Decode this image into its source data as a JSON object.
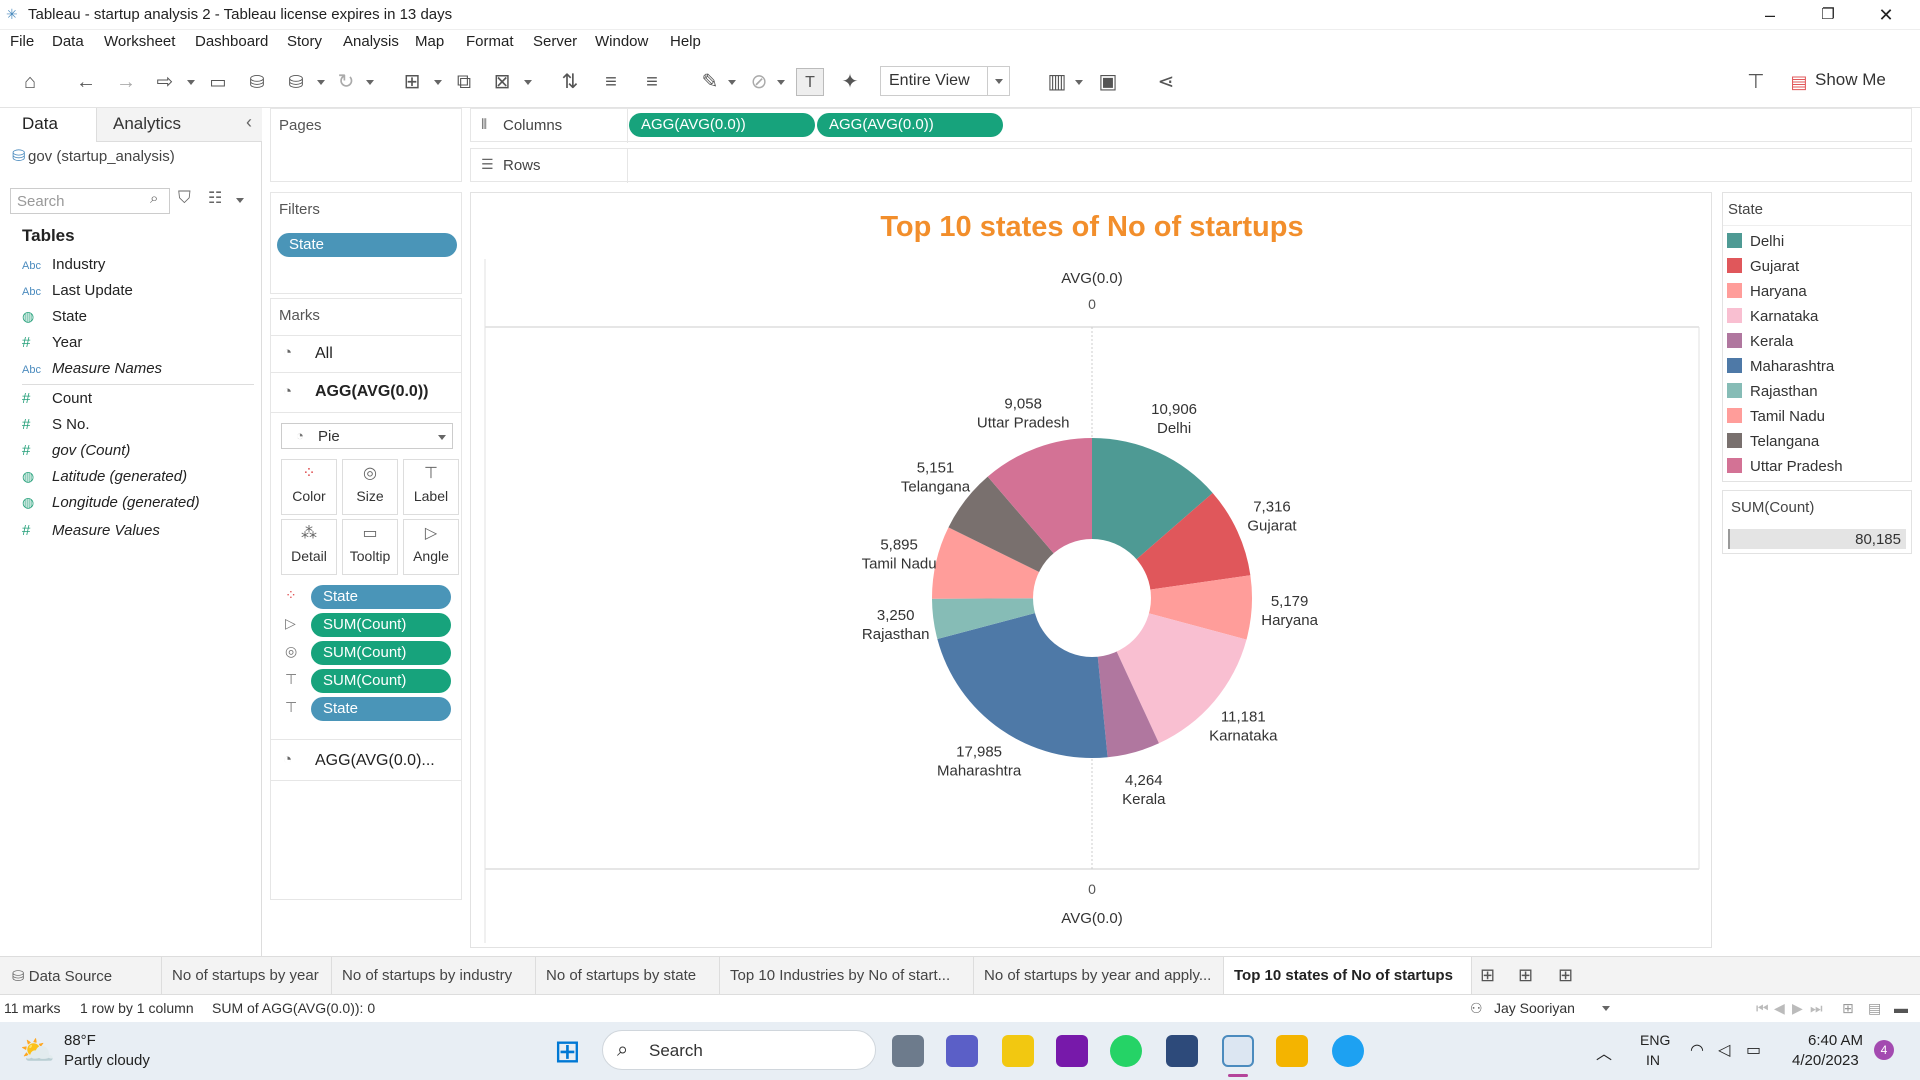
{
  "window": {
    "title": "Tableau - startup analysis 2 - Tableau license expires in 13 days"
  },
  "menu": [
    "File",
    "Data",
    "Worksheet",
    "Dashboard",
    "Story",
    "Analysis",
    "Map",
    "Format",
    "Server",
    "Window",
    "Help"
  ],
  "toolbar": {
    "view_select": "Entire View",
    "show_me": "Show Me"
  },
  "left_pane": {
    "tab_data": "Data",
    "tab_analytics": "Analytics",
    "datasource": "gov (startup_analysis)",
    "search_placeholder": "Search",
    "tables_heading": "Tables",
    "fields": [
      {
        "type": "Abc",
        "name": "Industry"
      },
      {
        "type": "Abc",
        "name": "Last Update"
      },
      {
        "type": "geo",
        "name": "State"
      },
      {
        "type": "#",
        "name": "Year"
      },
      {
        "type": "Abc",
        "name": "Measure Names"
      },
      {
        "type": "#",
        "name": "Count"
      },
      {
        "type": "#",
        "name": "S No."
      },
      {
        "type": "#",
        "name": "gov (Count)"
      },
      {
        "type": "geo",
        "name": "Latitude (generated)"
      },
      {
        "type": "geo",
        "name": "Longitude (generated)"
      },
      {
        "type": "#",
        "name": "Measure Values"
      }
    ]
  },
  "pages_card": {
    "title": "Pages"
  },
  "filters_card": {
    "title": "Filters",
    "pill": "State"
  },
  "marks_card": {
    "title": "Marks",
    "all": "All",
    "agg": "AGG(AVG(0.0))",
    "mark_type": "Pie",
    "buttons": [
      "Color",
      "Size",
      "Label",
      "Detail",
      "Tooltip",
      "Angle"
    ],
    "pills": [
      "State",
      "SUM(Count)",
      "SUM(Count)",
      "SUM(Count)",
      "State"
    ],
    "agg2": "AGG(AVG(0.0)..."
  },
  "shelves": {
    "columns_label": "Columns",
    "rows_label": "Rows",
    "column_pills": [
      "AGG(AVG(0.0))",
      "AGG(AVG(0.0))"
    ]
  },
  "viz": {
    "title": "Top 10 states of No of startups",
    "top_axis_label": "AVG(0.0)",
    "top_axis_tick": "0",
    "bottom_axis_tick": "0",
    "bottom_axis_label": "AVG(0.0)"
  },
  "chart_data": {
    "type": "pie",
    "title": "Top 10 states of No of startups",
    "donut": true,
    "categories": [
      "Delhi",
      "Gujarat",
      "Haryana",
      "Karnataka",
      "Kerala",
      "Maharashtra",
      "Rajasthan",
      "Tamil Nadu",
      "Telangana",
      "Uttar Pradesh"
    ],
    "values": [
      10906,
      7316,
      5179,
      11181,
      4264,
      17985,
      3250,
      5895,
      5151,
      9058
    ],
    "value_labels": [
      "10,906",
      "7,316",
      "5,179",
      "11,181",
      "4,264",
      "17,985",
      "3,250",
      "5,895",
      "5,151",
      "9,058"
    ],
    "colors": [
      "#4e9a94",
      "#e0575b",
      "#ff9d9a",
      "#f9bfd1",
      "#b0779f",
      "#4e79a7",
      "#86bcb6",
      "#ff9d9a",
      "#79706e",
      "#d37295"
    ],
    "legend_title": "State",
    "legend_position": "right"
  },
  "sum_card": {
    "title": "SUM(Count)",
    "value": "80,185"
  },
  "sheet_tabs": {
    "data_source": "Data Source",
    "tabs": [
      "No of startups by year",
      "No of startups by industry",
      "No of startups by state",
      "Top 10 Industries  by No of start...",
      "No of startups by year and apply...",
      "Top 10 states of No of startups"
    ]
  },
  "status": {
    "marks": "11 marks",
    "rowcol": "1 row by 1 column",
    "sum": "SUM of AGG(AVG(0.0)): 0",
    "user": "Jay Sooriyan"
  },
  "taskbar": {
    "temp": "88°F",
    "weather": "Partly cloudy",
    "search": "Search",
    "lang1": "ENG",
    "lang2": "IN",
    "time": "6:40 AM",
    "date": "4/20/2023",
    "notif": "4"
  }
}
